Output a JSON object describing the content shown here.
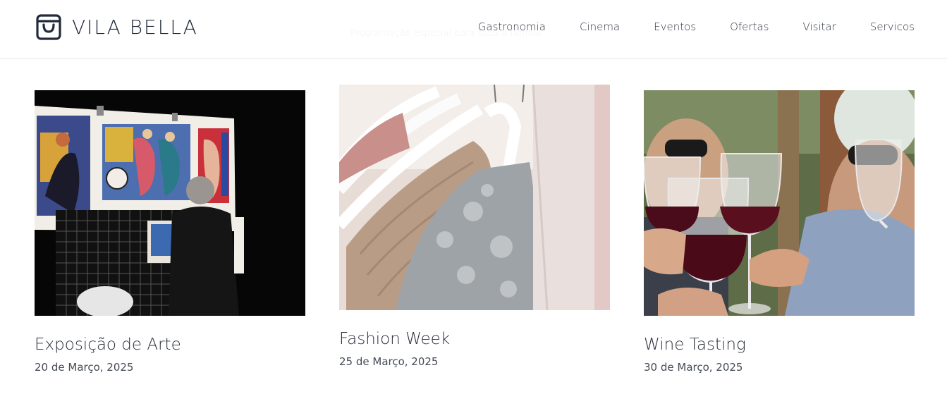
{
  "header": {
    "brand": "VILA BELLA",
    "logo_icon": "shopping-bag-icon",
    "faded_subtitle": "Programação especial para toda a família",
    "nav": [
      {
        "label": "Gastronomia"
      },
      {
        "label": "Cinema"
      },
      {
        "label": "Eventos"
      },
      {
        "label": "Ofertas"
      },
      {
        "label": "Visitar"
      },
      {
        "label": "Servicos"
      }
    ]
  },
  "events": [
    {
      "title": "Exposição de Arte",
      "date": "20 de Março, 2025",
      "image": "art-exhibition-photo"
    },
    {
      "title": "Fashion Week",
      "date": "25 de Março, 2025",
      "image": "clothes-hangers-photo"
    },
    {
      "title": "Wine Tasting",
      "date": "30 de Março, 2025",
      "image": "wine-toast-photo"
    }
  ],
  "colors": {
    "brand_text": "#222b3c",
    "nav_text": "#2f3440",
    "title_text": "#2a2f3a",
    "date_text": "#454b55"
  }
}
